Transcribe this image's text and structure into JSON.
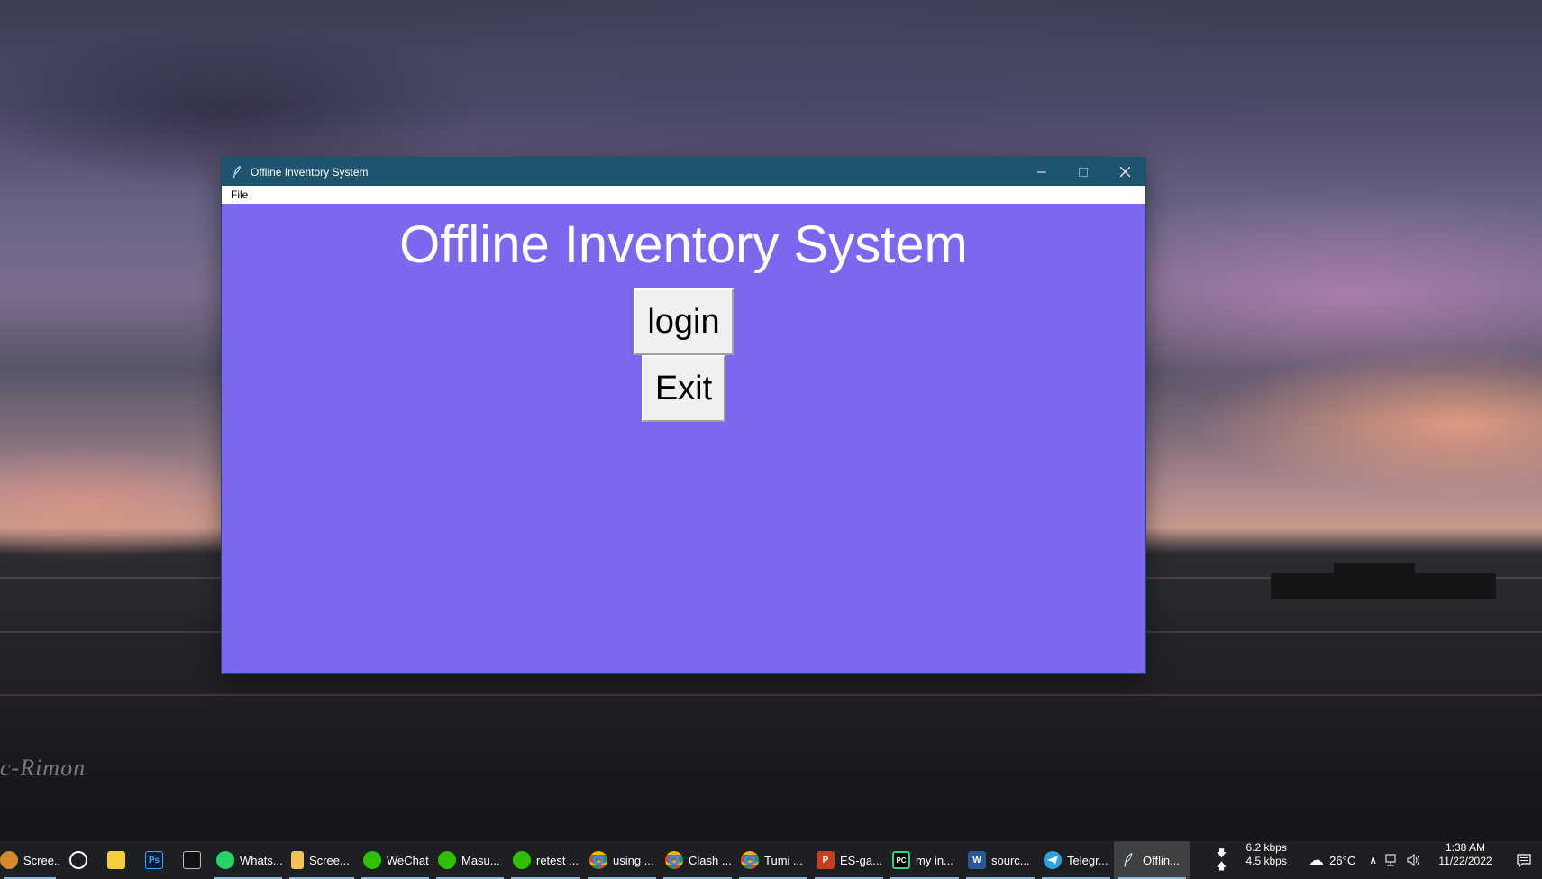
{
  "window": {
    "title": "Offline Inventory System",
    "menu": [
      "File"
    ],
    "heading": "Offline Inventory System",
    "buttons": {
      "login": "login",
      "exit": "Exit"
    },
    "background_color": "#7b68ee"
  },
  "desktop": {
    "watermark": "c-Rimon"
  },
  "taskbar": {
    "items": [
      {
        "label": "Scree...",
        "icon": "screenshot-icon"
      },
      {
        "label": "",
        "icon": "clock-app-icon"
      },
      {
        "label": "",
        "icon": "sticky-notes-icon"
      },
      {
        "label": "",
        "icon": "photoshop-icon",
        "text": "Ps"
      },
      {
        "label": "",
        "icon": "terminal-icon"
      },
      {
        "label": "Whats...",
        "icon": "whatsapp-icon"
      },
      {
        "label": "Scree...",
        "icon": "folder-icon"
      },
      {
        "label": "WeChat",
        "icon": "wechat-icon"
      },
      {
        "label": "Masu...",
        "icon": "wechat-icon"
      },
      {
        "label": "retest ...",
        "icon": "wechat-icon"
      },
      {
        "label": "using ...",
        "icon": "chrome-icon"
      },
      {
        "label": "Clash ...",
        "icon": "chrome-icon"
      },
      {
        "label": "Tumi ...",
        "icon": "chrome-icon"
      },
      {
        "label": "ES-ga...",
        "icon": "powerpoint-icon",
        "text": "P"
      },
      {
        "label": "my in...",
        "icon": "pycharm-icon",
        "text": "PC"
      },
      {
        "label": "sourc...",
        "icon": "word-icon",
        "text": "W"
      },
      {
        "label": "Telegr...",
        "icon": "telegram-icon"
      },
      {
        "label": "Offlin...",
        "icon": "feather-icon"
      }
    ],
    "tray": {
      "download_speed": "6.2 kbps",
      "upload_speed": "4.5 kbps",
      "temperature": "26°C",
      "time": "1:38 AM",
      "date": "11/22/2022"
    }
  }
}
